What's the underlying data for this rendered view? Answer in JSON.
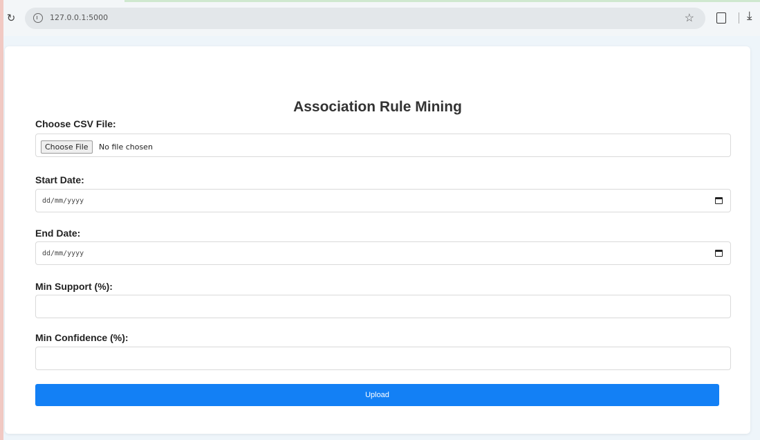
{
  "browser": {
    "url": "127.0.0.1:5000"
  },
  "form": {
    "title": "Association Rule Mining",
    "csv_label": "Choose CSV File:",
    "file_button": "Choose File",
    "file_status": "No file chosen",
    "start_label": "Start Date:",
    "start_placeholder": "dd/mm/yyyy",
    "end_label": "End Date:",
    "end_placeholder": "dd/mm/yyyy",
    "support_label": "Min Support (%):",
    "support_value": "",
    "confidence_label": "Min Confidence (%):",
    "confidence_value": "",
    "upload_label": "Upload"
  },
  "colors": {
    "accent": "#1380f5",
    "page_bg": "#eef5fa"
  }
}
